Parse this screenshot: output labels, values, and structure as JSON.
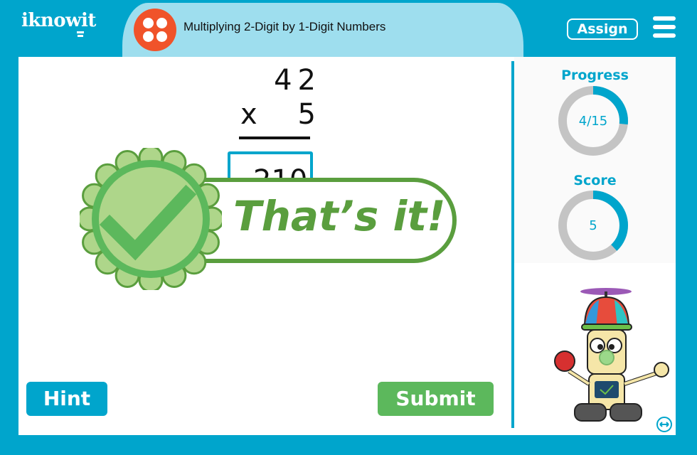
{
  "header": {
    "logo": "iknowit",
    "title": "Multiplying 2-Digit by 1-Digit Numbers",
    "assign_label": "Assign",
    "menu_icon": "hamburger-menu-icon"
  },
  "problem": {
    "top_number": "42",
    "operator": "x",
    "bottom_number": "5",
    "answer": "210"
  },
  "feedback": {
    "message": "That’s it!",
    "icon": "checkmark-seal-icon"
  },
  "buttons": {
    "hint_label": "Hint",
    "submit_label": "Submit"
  },
  "sidebar": {
    "progress": {
      "label": "Progress",
      "current": 4,
      "total": 15,
      "display": "4/15"
    },
    "score": {
      "label": "Score",
      "value": 5,
      "display": "5",
      "fill_fraction": 0.38
    }
  },
  "colors": {
    "brand_blue": "#00a5cc",
    "title_bg": "#9edeee",
    "accent_orange": "#f0532a",
    "success_green": "#5cb85c",
    "banner_green": "#5a9e3e",
    "ring_gray": "#c4c4c4"
  }
}
